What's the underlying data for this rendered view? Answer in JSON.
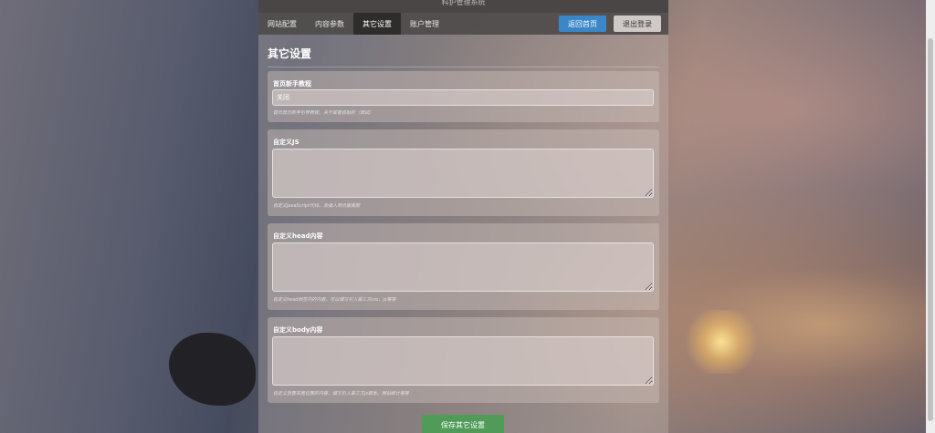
{
  "app": {
    "system_title": "科护管理系统"
  },
  "nav": {
    "tabs": [
      {
        "label": "网站配置",
        "active": false
      },
      {
        "label": "内容参数",
        "active": false
      },
      {
        "label": "其它设置",
        "active": true
      },
      {
        "label": "账户管理",
        "active": false
      }
    ],
    "home_button": "返回首页",
    "logout_button": "退出登录"
  },
  "page": {
    "title": "其它设置"
  },
  "settings": {
    "tutorial": {
      "label": "首页新手教程",
      "value": "关闭",
      "hint": "首页显示新手引导教程，关于或者自助的（调试）"
    },
    "custom_js": {
      "label": "自定义JS",
      "value": "",
      "hint": "自定义JavaScript代码，会插入到页面底部"
    },
    "custom_head": {
      "label": "自定义head内容",
      "value": "",
      "hint": "自定义head标签内的内容，可以填写引入第三方css、js等等"
    },
    "custom_body": {
      "label": "自定义body内容",
      "value": "",
      "hint": "自定义放置末尾位置的内容，填写引入第三方js脚本、网站统计等等"
    }
  },
  "actions": {
    "save_label": "保存其它设置"
  },
  "colors": {
    "primary": "#3a86c8",
    "success": "#4f9b57",
    "nav_bg": "#4e4a49"
  }
}
